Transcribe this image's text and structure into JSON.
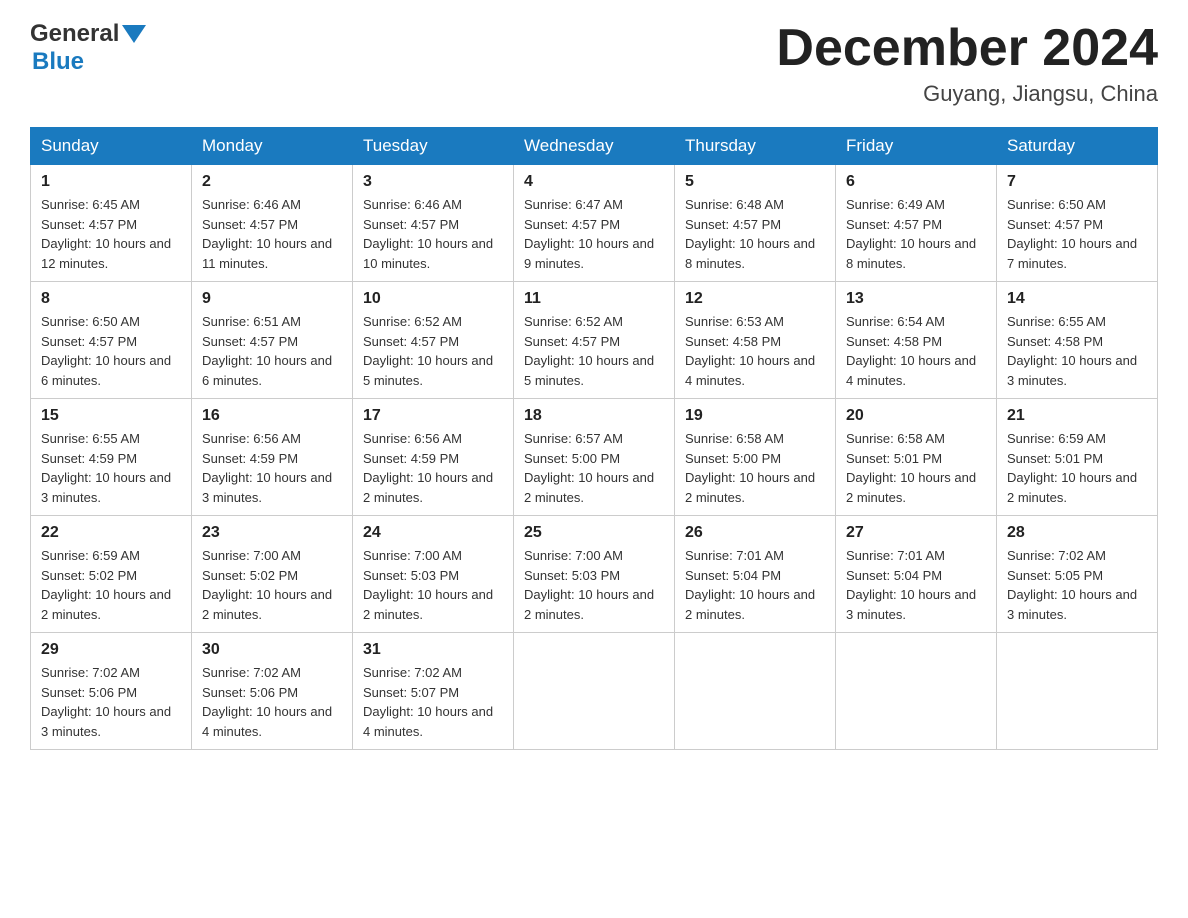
{
  "header": {
    "logo_general": "General",
    "logo_blue": "Blue",
    "month_title": "December 2024",
    "location": "Guyang, Jiangsu, China"
  },
  "calendar": {
    "days_of_week": [
      "Sunday",
      "Monday",
      "Tuesday",
      "Wednesday",
      "Thursday",
      "Friday",
      "Saturday"
    ],
    "weeks": [
      [
        {
          "day": "1",
          "sunrise": "Sunrise: 6:45 AM",
          "sunset": "Sunset: 4:57 PM",
          "daylight": "Daylight: 10 hours and 12 minutes."
        },
        {
          "day": "2",
          "sunrise": "Sunrise: 6:46 AM",
          "sunset": "Sunset: 4:57 PM",
          "daylight": "Daylight: 10 hours and 11 minutes."
        },
        {
          "day": "3",
          "sunrise": "Sunrise: 6:46 AM",
          "sunset": "Sunset: 4:57 PM",
          "daylight": "Daylight: 10 hours and 10 minutes."
        },
        {
          "day": "4",
          "sunrise": "Sunrise: 6:47 AM",
          "sunset": "Sunset: 4:57 PM",
          "daylight": "Daylight: 10 hours and 9 minutes."
        },
        {
          "day": "5",
          "sunrise": "Sunrise: 6:48 AM",
          "sunset": "Sunset: 4:57 PM",
          "daylight": "Daylight: 10 hours and 8 minutes."
        },
        {
          "day": "6",
          "sunrise": "Sunrise: 6:49 AM",
          "sunset": "Sunset: 4:57 PM",
          "daylight": "Daylight: 10 hours and 8 minutes."
        },
        {
          "day": "7",
          "sunrise": "Sunrise: 6:50 AM",
          "sunset": "Sunset: 4:57 PM",
          "daylight": "Daylight: 10 hours and 7 minutes."
        }
      ],
      [
        {
          "day": "8",
          "sunrise": "Sunrise: 6:50 AM",
          "sunset": "Sunset: 4:57 PM",
          "daylight": "Daylight: 10 hours and 6 minutes."
        },
        {
          "day": "9",
          "sunrise": "Sunrise: 6:51 AM",
          "sunset": "Sunset: 4:57 PM",
          "daylight": "Daylight: 10 hours and 6 minutes."
        },
        {
          "day": "10",
          "sunrise": "Sunrise: 6:52 AM",
          "sunset": "Sunset: 4:57 PM",
          "daylight": "Daylight: 10 hours and 5 minutes."
        },
        {
          "day": "11",
          "sunrise": "Sunrise: 6:52 AM",
          "sunset": "Sunset: 4:57 PM",
          "daylight": "Daylight: 10 hours and 5 minutes."
        },
        {
          "day": "12",
          "sunrise": "Sunrise: 6:53 AM",
          "sunset": "Sunset: 4:58 PM",
          "daylight": "Daylight: 10 hours and 4 minutes."
        },
        {
          "day": "13",
          "sunrise": "Sunrise: 6:54 AM",
          "sunset": "Sunset: 4:58 PM",
          "daylight": "Daylight: 10 hours and 4 minutes."
        },
        {
          "day": "14",
          "sunrise": "Sunrise: 6:55 AM",
          "sunset": "Sunset: 4:58 PM",
          "daylight": "Daylight: 10 hours and 3 minutes."
        }
      ],
      [
        {
          "day": "15",
          "sunrise": "Sunrise: 6:55 AM",
          "sunset": "Sunset: 4:59 PM",
          "daylight": "Daylight: 10 hours and 3 minutes."
        },
        {
          "day": "16",
          "sunrise": "Sunrise: 6:56 AM",
          "sunset": "Sunset: 4:59 PM",
          "daylight": "Daylight: 10 hours and 3 minutes."
        },
        {
          "day": "17",
          "sunrise": "Sunrise: 6:56 AM",
          "sunset": "Sunset: 4:59 PM",
          "daylight": "Daylight: 10 hours and 2 minutes."
        },
        {
          "day": "18",
          "sunrise": "Sunrise: 6:57 AM",
          "sunset": "Sunset: 5:00 PM",
          "daylight": "Daylight: 10 hours and 2 minutes."
        },
        {
          "day": "19",
          "sunrise": "Sunrise: 6:58 AM",
          "sunset": "Sunset: 5:00 PM",
          "daylight": "Daylight: 10 hours and 2 minutes."
        },
        {
          "day": "20",
          "sunrise": "Sunrise: 6:58 AM",
          "sunset": "Sunset: 5:01 PM",
          "daylight": "Daylight: 10 hours and 2 minutes."
        },
        {
          "day": "21",
          "sunrise": "Sunrise: 6:59 AM",
          "sunset": "Sunset: 5:01 PM",
          "daylight": "Daylight: 10 hours and 2 minutes."
        }
      ],
      [
        {
          "day": "22",
          "sunrise": "Sunrise: 6:59 AM",
          "sunset": "Sunset: 5:02 PM",
          "daylight": "Daylight: 10 hours and 2 minutes."
        },
        {
          "day": "23",
          "sunrise": "Sunrise: 7:00 AM",
          "sunset": "Sunset: 5:02 PM",
          "daylight": "Daylight: 10 hours and 2 minutes."
        },
        {
          "day": "24",
          "sunrise": "Sunrise: 7:00 AM",
          "sunset": "Sunset: 5:03 PM",
          "daylight": "Daylight: 10 hours and 2 minutes."
        },
        {
          "day": "25",
          "sunrise": "Sunrise: 7:00 AM",
          "sunset": "Sunset: 5:03 PM",
          "daylight": "Daylight: 10 hours and 2 minutes."
        },
        {
          "day": "26",
          "sunrise": "Sunrise: 7:01 AM",
          "sunset": "Sunset: 5:04 PM",
          "daylight": "Daylight: 10 hours and 2 minutes."
        },
        {
          "day": "27",
          "sunrise": "Sunrise: 7:01 AM",
          "sunset": "Sunset: 5:04 PM",
          "daylight": "Daylight: 10 hours and 3 minutes."
        },
        {
          "day": "28",
          "sunrise": "Sunrise: 7:02 AM",
          "sunset": "Sunset: 5:05 PM",
          "daylight": "Daylight: 10 hours and 3 minutes."
        }
      ],
      [
        {
          "day": "29",
          "sunrise": "Sunrise: 7:02 AM",
          "sunset": "Sunset: 5:06 PM",
          "daylight": "Daylight: 10 hours and 3 minutes."
        },
        {
          "day": "30",
          "sunrise": "Sunrise: 7:02 AM",
          "sunset": "Sunset: 5:06 PM",
          "daylight": "Daylight: 10 hours and 4 minutes."
        },
        {
          "day": "31",
          "sunrise": "Sunrise: 7:02 AM",
          "sunset": "Sunset: 5:07 PM",
          "daylight": "Daylight: 10 hours and 4 minutes."
        },
        null,
        null,
        null,
        null
      ]
    ]
  }
}
